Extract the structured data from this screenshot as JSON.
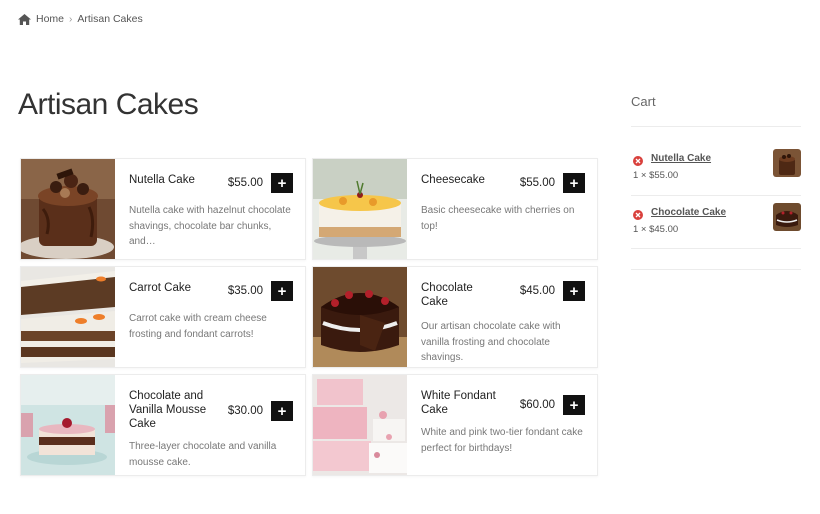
{
  "breadcrumb": {
    "home": "Home",
    "separator": "›",
    "current": "Artisan Cakes"
  },
  "page_title": "Artisan Cakes",
  "add_label": "+",
  "products": [
    {
      "name": "Nutella Cake",
      "price": "$55.00",
      "description": "Nutella cake with hazelnut chocolate shavings, chocolate bar chunks, and…"
    },
    {
      "name": "Cheesecake",
      "price": "$55.00",
      "description": "Basic cheesecake with cherries on top!"
    },
    {
      "name": "Carrot Cake",
      "price": "$35.00",
      "description": "Carrot cake with cream cheese frosting and fondant carrots!"
    },
    {
      "name": "Chocolate Cake",
      "price": "$45.00",
      "description": "Our artisan chocolate cake with vanilla frosting and chocolate shavings."
    },
    {
      "name": "Chocolate and Vanilla Mousse Cake",
      "price": "$30.00",
      "description": "Three-layer chocolate and vanilla mousse cake."
    },
    {
      "name": "White Fondant Cake",
      "price": "$60.00",
      "description": "White and pink two-tier fondant cake perfect for birthdays!"
    }
  ],
  "cart": {
    "title": "Cart",
    "items": [
      {
        "name": "Nutella Cake",
        "qty_price": "1 × $55.00"
      },
      {
        "name": "Chocolate Cake",
        "qty_price": "1 × $45.00"
      }
    ]
  },
  "colors": {
    "accent": "#111111",
    "remove": "#d9413d",
    "border": "#ececec"
  }
}
